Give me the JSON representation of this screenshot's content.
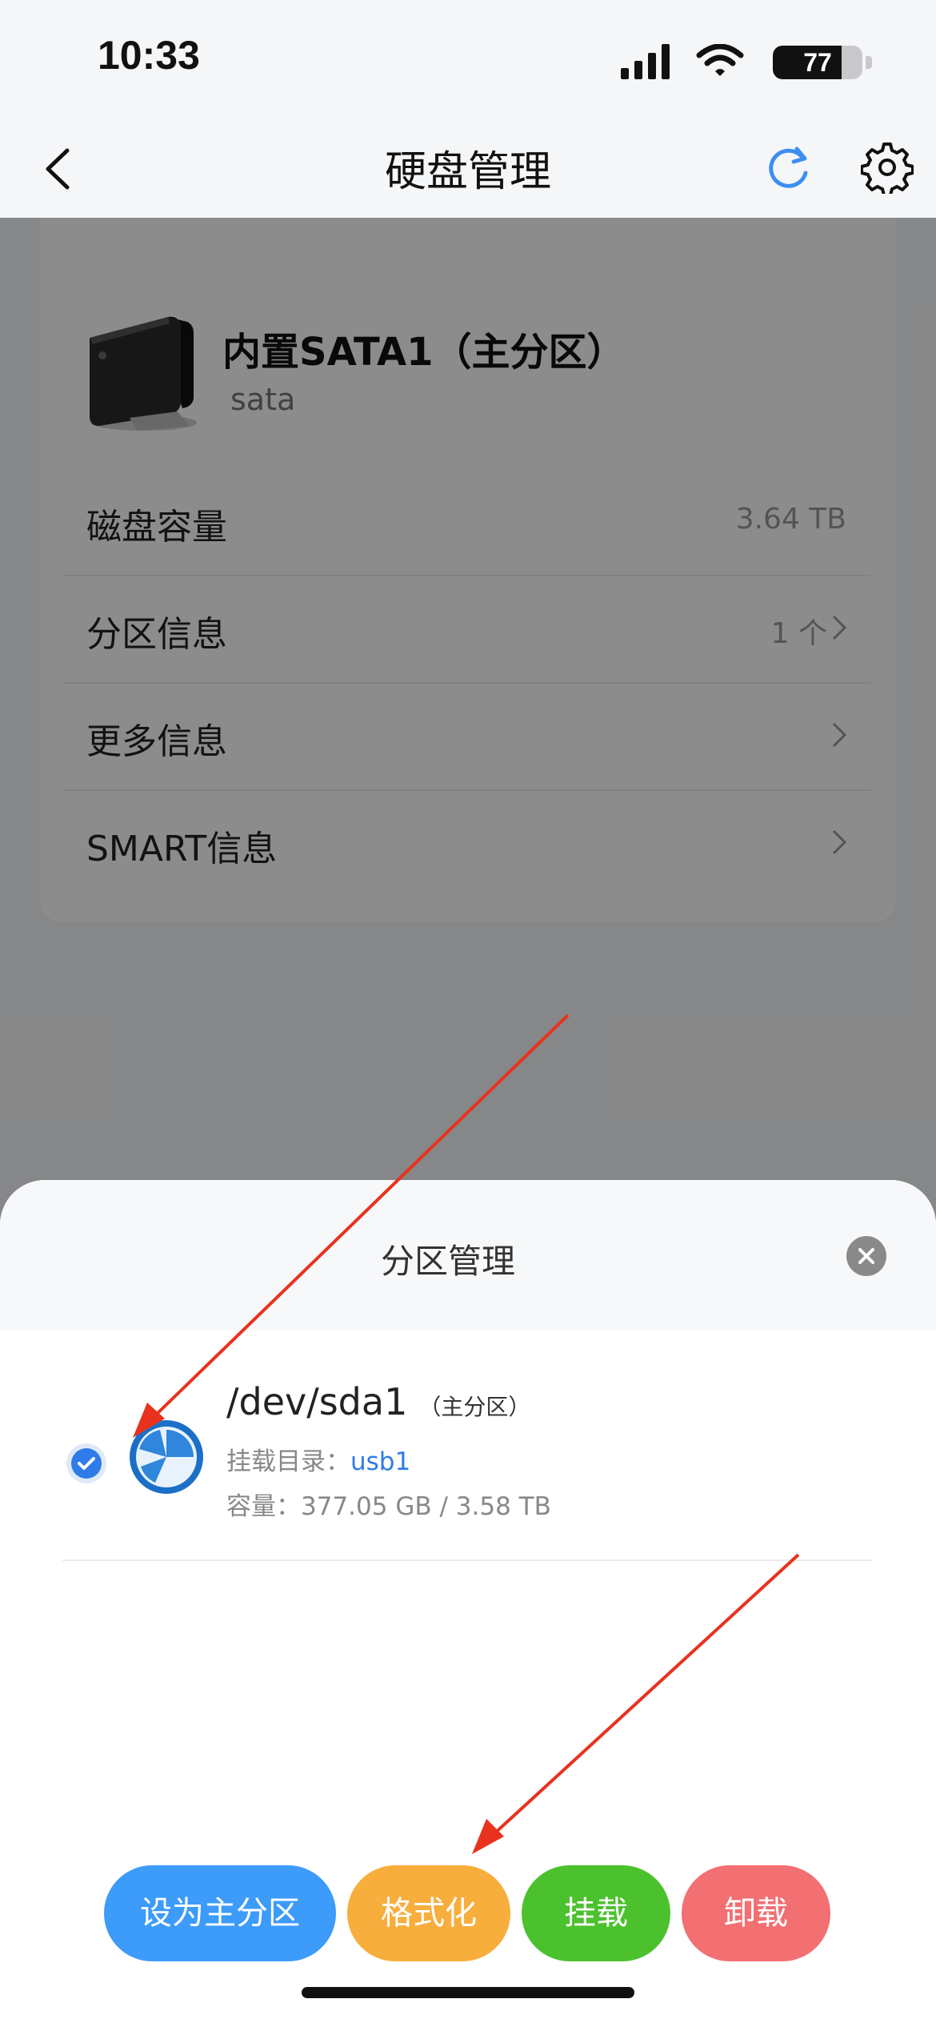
{
  "status_bar": {
    "time": "10:33",
    "battery": "77",
    "battery_level": 0.77
  },
  "nav": {
    "title": "硬盘管理"
  },
  "disk": {
    "name": "内置SATA1（主分区）",
    "type": "sata",
    "rows": [
      {
        "label": "磁盘容量",
        "value": "3.64 TB"
      },
      {
        "label": "分区信息",
        "value": "1 个"
      },
      {
        "label": "更多信息",
        "value": ""
      },
      {
        "label": "SMART信息",
        "value": ""
      }
    ]
  },
  "sheet": {
    "title": "分区管理",
    "partition": {
      "name": "/dev/sda1",
      "tag": "（主分区）",
      "mount_label": "挂载目录：",
      "mount_value": "usb1",
      "capacity": "容量：377.05 GB / 3.58 TB"
    },
    "buttons": {
      "set_primary": "设为主分区",
      "format": "格式化",
      "mount": "挂载",
      "unmount": "卸载"
    }
  },
  "colors": {
    "accent_blue": "#3d9bfa",
    "format_orange": "#f8ae3c",
    "mount_green": "#4cc12e",
    "unmount_red": "#f26f72",
    "link_blue": "#2f7be8",
    "annotation_arrow": "#e8321e"
  },
  "icons": {
    "back": "chevron-left-icon",
    "refresh": "refresh-icon",
    "settings": "gear-icon",
    "close": "close-icon",
    "check": "check-circle-icon",
    "partition": "pie-chart-icon",
    "disk": "hard-drive-icon"
  }
}
